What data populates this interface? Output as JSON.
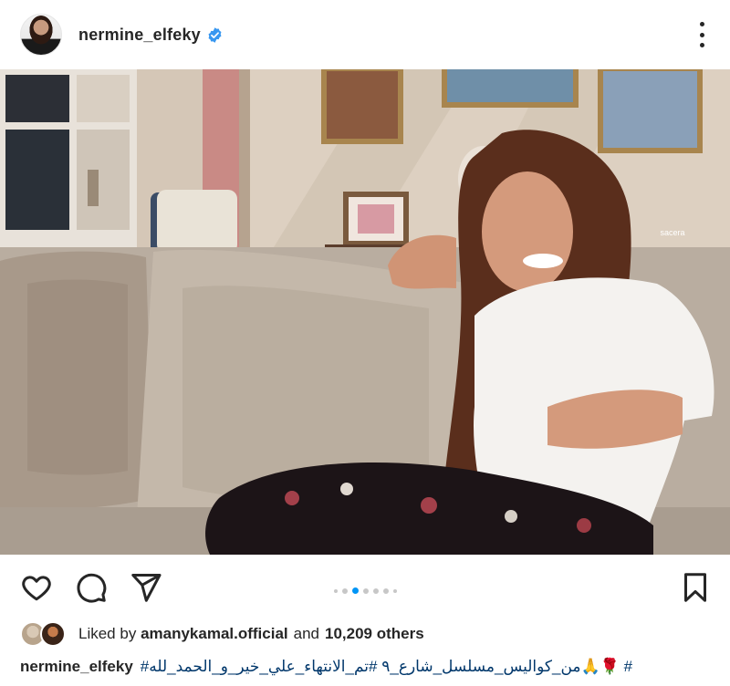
{
  "post": {
    "username": "nermine_elfeky",
    "verified_icon": "verified-badge-icon",
    "more_icon": "more-options-icon",
    "image_watermark": "sacera"
  },
  "actions": {
    "like_icon": "heart-icon",
    "comment_icon": "comment-icon",
    "share_icon": "send-icon",
    "save_icon": "bookmark-icon",
    "carousel": {
      "total": 7,
      "active_index": 2
    }
  },
  "likes": {
    "prefix": "Liked by",
    "user": "amanykamal.official",
    "middle": "and",
    "others": "10,209 others"
  },
  "caption": {
    "username": "nermine_elfeky",
    "text": "# 🌹🙏من_كواليس_مسلسل_شارع_٩ #تم_الانتهاء_علي_خير_و_الحمد_لله#"
  },
  "colors": {
    "accent": "#0095f6",
    "verified": "#3897f0",
    "hashtag": "#00376b",
    "text": "#262626"
  }
}
